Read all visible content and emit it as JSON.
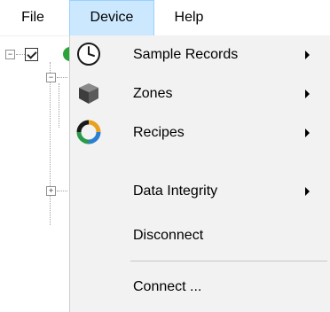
{
  "menubar": {
    "file_label": "File",
    "device_label": "Device",
    "help_label": "Help"
  },
  "tree": {
    "expander_collapse": "−",
    "expander_expand": "+"
  },
  "device_menu": {
    "items": [
      {
        "label": "Sample Records",
        "icon": "clock-icon",
        "has_submenu": true
      },
      {
        "label": "Zones",
        "icon": "cube-icon",
        "has_submenu": true
      },
      {
        "label": "Recipes",
        "icon": "recipes-icon",
        "has_submenu": true
      },
      {
        "label": "Data Integrity",
        "icon": "",
        "has_submenu": true
      },
      {
        "label": "Disconnect",
        "icon": "",
        "has_submenu": false
      },
      {
        "label": "Connect ...",
        "icon": "",
        "has_submenu": false
      }
    ]
  },
  "colors": {
    "menu_highlight": "#cce8ff",
    "menu_highlight_border": "#99d1ff",
    "dropdown_background": "#f2f2f2"
  }
}
